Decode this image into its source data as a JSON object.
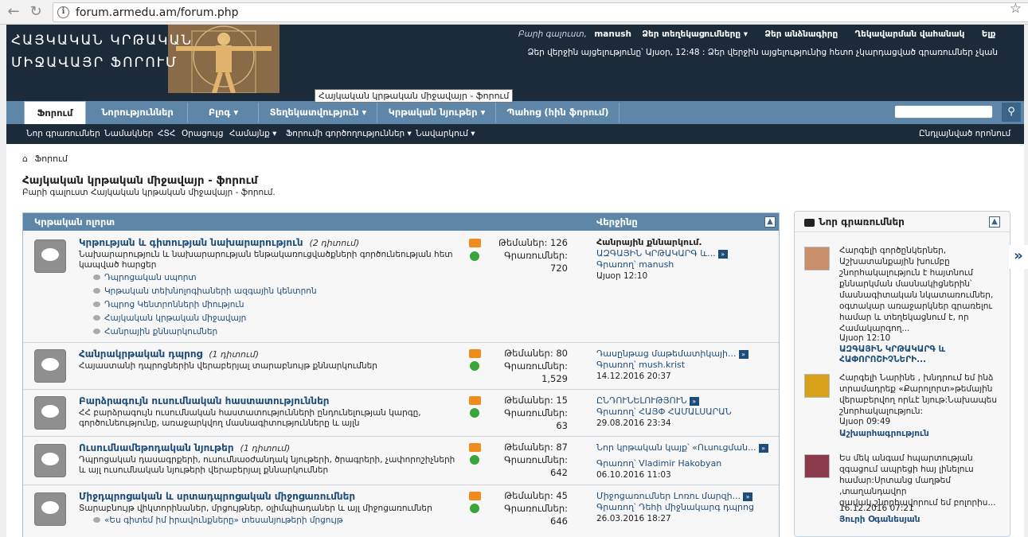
{
  "browser": {
    "url": "forum.armedu.am/forum.php",
    "info_icon": "i"
  },
  "header": {
    "site_title": "ՀԱՅԿԱԿԱՆ ԿՐԹԱԿԱՆ ՄԻՋԱՎԱՅՐ ՖՈՐՈՒՄ",
    "welcome_label": "Բարի գալուստ,",
    "username": "manush",
    "links": [
      "Ձեր տեղեկացումները ▾",
      "Ձեր անձնագիրը",
      "Ղեկավարման վահանակ",
      "Ելք"
    ],
    "last_visit": "Ձեր վերջին այցելությունը՝ Այսօր, 12:48 : Ձեր վերջին այցելությունից հետո չկարդացված գրառումներ չկան"
  },
  "tabs": [
    {
      "label": "Ֆորում"
    },
    {
      "label": "Նորություններ"
    },
    {
      "label": "Բլոգ ▾"
    },
    {
      "label": "Տեղեկատվություն ▾"
    },
    {
      "label": "Կրթական նյութեր ▾"
    },
    {
      "label": "Պահոց (հին ֆորում)"
    }
  ],
  "tooltip": "Հայկական կրթական միջավայր - ֆորում",
  "subnav": {
    "items": [
      "Նոր գրառումներ",
      "Նամակներ",
      "ՀՏՀ",
      "Օրացույց",
      "Համայնք ▾",
      "Ֆորումի գործողություններ ▾",
      "Նավարկում ▾"
    ],
    "advanced_search": "Ընդլայնված որոնում"
  },
  "main": {
    "breadcrumb": "Ֆորում",
    "title": "Հայկական կրթական միջավայր - ֆորում",
    "description": "Բարի գալուստ Հայկական կրթական միջավայր - ֆորում."
  },
  "forum_block": {
    "col_title": "Կրթական ոլորտ",
    "col_last": "Վերջինը",
    "rows": [
      {
        "title": "Կրթության և գիտության նախարարություն",
        "viewing": "(2 դիտում)",
        "desc": "Նախարարություն և նախարարության ենթակառուցվածքների գործունեության հետ կապված հարցեր",
        "subforums": [
          "Դպրոցական սպորտ",
          "Կրթական տեխնոլոգիաների ազգային կենտրոն",
          "Դպրոց Կենտրոնների միություն",
          "Հայկական կրթական միջավայր",
          "Հանրային քննարկումներ"
        ],
        "topics": "Թեմաներ: 126",
        "posts_label": "Գրառումներ:",
        "posts": "720",
        "last_title": "Հանրային քննարկում.",
        "last_sub": "ԱԶԳԱՅԻՆ ԿՐԹԱԿԱՐԳ և...",
        "last_by_label": "Գրառող՝",
        "last_by": "manush",
        "last_time": "Այսօր 12:10"
      },
      {
        "title": "Հանրակրթական դպրոց",
        "viewing": "(1 դիտում)",
        "desc": "Հայաստանի դպրոցներին վերաբերյալ տարաբնույթ քննարկումներ",
        "topics": "Թեմաներ: 80",
        "posts_label": "Գրառումներ:",
        "posts": "1,529",
        "last_title": "Դասընթաց մաթեմատիկայի...",
        "last_by_label": "Գրառող՝",
        "last_by": "mush.krist",
        "last_time": "14.12.2016 20:37"
      },
      {
        "title": "Բարձրագույն ուսումնական հաստատություններ",
        "desc": "ՀՀ բարձրագույն ուսումնական հաստատությունների ընդունելության կարգը, գործունեությունը, առաջարկվող մասնագիտությունները և այլն",
        "topics": "Թեմաներ: 15",
        "posts_label": "Գրառումներ:",
        "posts": "63",
        "last_title": "ԸՆԴՈՒՆԵԼՈՒԹՅՈՒՆ",
        "last_by_label": "Գրառող՝",
        "last_by": "ՀԱՅՓ ՀԱՄԱԼՍԱՐԱՆ",
        "last_time": "29.08.2016 23:34"
      },
      {
        "title": "Ուսումնամեթոդական նյութեր",
        "viewing": "(1 դիտում)",
        "desc": "Դպրոցական դասագրքերի, ուսումնաօժանդակ նյութերի, ծրագրերի, չափորոշիչների և այլ ուսումնական նյութերի վերաբերյալ քննարկումներ",
        "topics": "Թեմաներ: 87",
        "posts_label": "Գրառումներ:",
        "posts": "642",
        "last_title": "Նոր կրթական կայք՝ «Ուսուցման...",
        "last_by_label": "Գրառող՝",
        "last_by": "Vladimir Hakobyan",
        "last_time": "06.10.2016 11:03"
      },
      {
        "title": "Միջդպրոցական և սրտադպրոցական միջոցառումներ",
        "desc": "Տարաբնույթ վիկտորինաներ, մրցույթներ, օլիմպիադաներ և այլ միջոցառումներ",
        "subforums": [
          "«Ես գիտեմ իմ իրավունքները» տեսանյութերի մրցույթ"
        ],
        "topics": "Թեմաներ: 45",
        "posts_label": "Գրառումներ:",
        "posts": "646",
        "last_title": "Միջոցառումներ Լոռու մարզի...",
        "last_by_label": "Գրառող՝",
        "last_by": "Դեհի միջնակարգ դպրոց",
        "last_time": "26.03.2016 18:27"
      }
    ]
  },
  "sidebar": {
    "title": "Նոր գրառումներ",
    "posts": [
      {
        "text": "Հարգելի գործընկերներ, Աշխատանքային խումբը շնորհակալություն է հայտնում քննարկման մասնակիցներին՝ մասնագիտական նկատառումներ, օգտակար առաջարկներ գրառելու համար և տեղեկացնում է, որ Համակարգող...",
        "time": "Այսօր 12:10",
        "thread": "ԱԶԳԱՅԻՆ ԿՐԹԱԿԱՐԳ և ՀԱՓՈՐՈՇԻՉՆԵՐԻ...",
        "avatar_color": "#c98f6a"
      },
      {
        "text": "Հարգելի Նարինե , խնդրում եմ ինձ տրամադրեք «Քարոլորտ»թեմային վերաբերվող որևէ նյութ:Նախապես շնորհակալություն:",
        "time": "Այսօր 09:49",
        "thread": "Աշխարհագրություն",
        "avatar_color": "#d7a21a"
      },
      {
        "text": "Ես մեկ անգամ հպարտության զգացում ապրեցի հայ լինելուս համար:Սրտանց մաղթեմ ,տաղանդավոր զավակ,շնորհավորում եմ բոլորիս...",
        "time": "16.12.2016 07:21",
        "thread": "Յուրի Օգանեսյան",
        "avatar_color": "#8a3a4a"
      }
    ]
  }
}
